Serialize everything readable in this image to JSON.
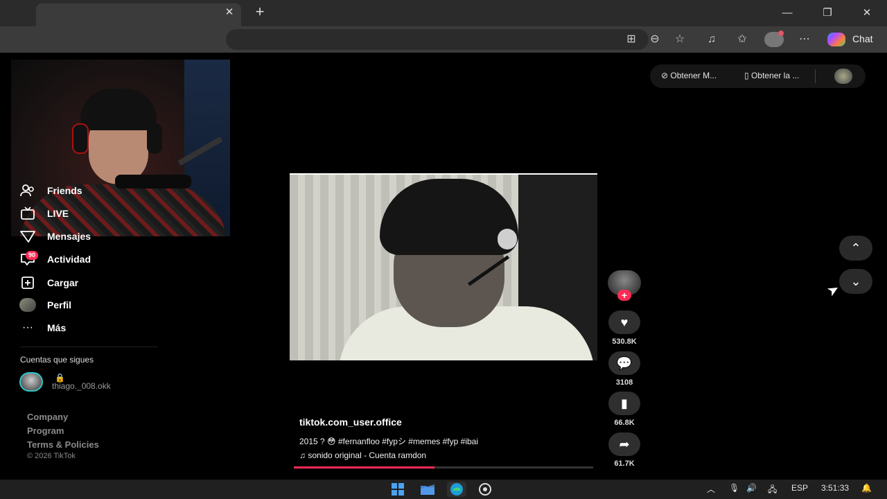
{
  "browser": {
    "tab_close": "✕",
    "new_tab": "+",
    "minimize": "—",
    "restore": "❐",
    "close": "✕",
    "chat_label": "Chat",
    "toolbar_icons": [
      "grid-apps-icon",
      "zoom-icon",
      "favorite-star-icon",
      "collections-icon",
      "favorites-list-icon",
      "profile-icon",
      "more-icon"
    ]
  },
  "sidebar": {
    "items": [
      {
        "label": "Friends",
        "icon": "friends-icon"
      },
      {
        "label": "LIVE",
        "icon": "live-icon"
      },
      {
        "label": "Mensajes",
        "icon": "messages-icon"
      },
      {
        "label": "Actividad",
        "icon": "activity-icon",
        "badge": "90"
      },
      {
        "label": "Cargar",
        "icon": "upload-icon"
      },
      {
        "label": "Perfil",
        "icon": "profile-icon"
      },
      {
        "label": "Más",
        "icon": "more-icon"
      }
    ],
    "following_title": "Cuentas que sigues",
    "following": [
      {
        "top": "🔒",
        "name": "thiago._008.okk"
      }
    ],
    "footer_links": [
      "Company",
      "Program",
      "Terms & Policies"
    ],
    "copyright": "© 2026 TikTok"
  },
  "top_pill": {
    "item1": "Obtener M...",
    "item2": "Obtener la ..."
  },
  "video": {
    "author": "tiktok.com_user.office",
    "description": "2015 ? 😳 #fernanfloo #fypシ #memes #fyp #ibai",
    "music": "sonido original - Cuenta ramdon",
    "progress": 0.47,
    "actions": {
      "likes": "530.8K",
      "comments": "3108",
      "saves": "66.8K",
      "shares": "61.7K"
    }
  },
  "taskbar": {
    "apps": [
      "windows-start-icon",
      "file-explorer-icon",
      "edge-icon",
      "obs-icon"
    ],
    "language": "ESP",
    "time": "3:51:33"
  }
}
